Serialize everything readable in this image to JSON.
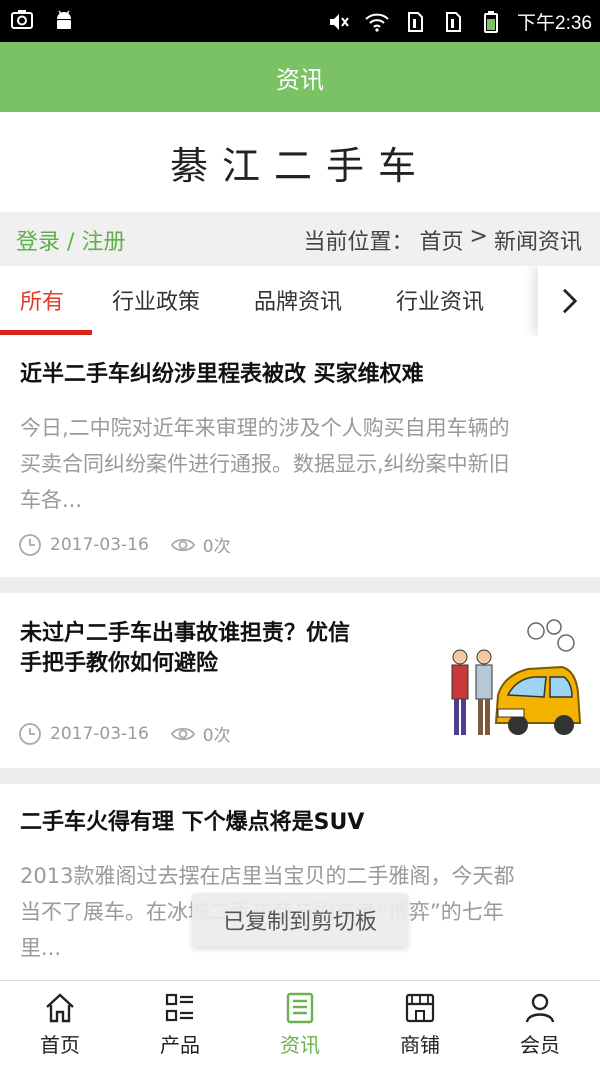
{
  "status_bar": {
    "time": "下午2:36",
    "icons_left": [
      "camera-icon",
      "android-icon"
    ],
    "icons_right": [
      "mute-icon",
      "wifi-icon",
      "sim1-icon",
      "sim2-icon",
      "battery-icon"
    ]
  },
  "header": {
    "title": "资讯"
  },
  "site": {
    "name": "綦江二手车"
  },
  "user_bar": {
    "login": "登录",
    "separator": "/",
    "register": "注册",
    "location_label": "当前位置：",
    "breadcrumb_home": "首页",
    "breadcrumb_sep": ">",
    "breadcrumb_current": "新闻资讯"
  },
  "tabs": [
    {
      "label": "所有",
      "active": true
    },
    {
      "label": "行业政策",
      "active": false
    },
    {
      "label": "品牌资讯",
      "active": false
    },
    {
      "label": "行业资讯",
      "active": false
    }
  ],
  "articles": [
    {
      "title": "近半二手车纠纷涉里程表被改 买家维权难",
      "summary_lines": [
        "今日,二中院对近年来审理的涉及个人购买自用车辆的",
        "买卖合同纠纷案件进行通报。数据显示,纠纷案中新旧",
        "车各..."
      ],
      "date": "2017-03-16",
      "views": "0次"
    },
    {
      "title_lines": [
        "未过户二手车出事故谁担责？优信",
        "手把手教你如何避险"
      ],
      "date": "2017-03-16",
      "views": "0次",
      "has_image": true
    },
    {
      "title": "二手车火得有理 下个爆点将是SUV",
      "summary_lines": [
        "2013款雅阁过去摆在店里当宝贝的二手雅阁，今天都",
        "当不了展车。在冰城二手车商与购车者“博弈”的七年",
        "里..."
      ]
    }
  ],
  "toast": {
    "text": "已复制到剪切板"
  },
  "bottom_nav": [
    {
      "label": "首页",
      "icon": "home-icon",
      "active": false
    },
    {
      "label": "产品",
      "icon": "products-icon",
      "active": false
    },
    {
      "label": "资讯",
      "icon": "news-icon",
      "active": true
    },
    {
      "label": "商铺",
      "icon": "shop-icon",
      "active": false
    },
    {
      "label": "会员",
      "icon": "member-icon",
      "active": false
    }
  ],
  "colors": {
    "primary_green": "#7ac263",
    "active_tab_red": "#e23b2e",
    "link_green": "#5fb04a"
  }
}
